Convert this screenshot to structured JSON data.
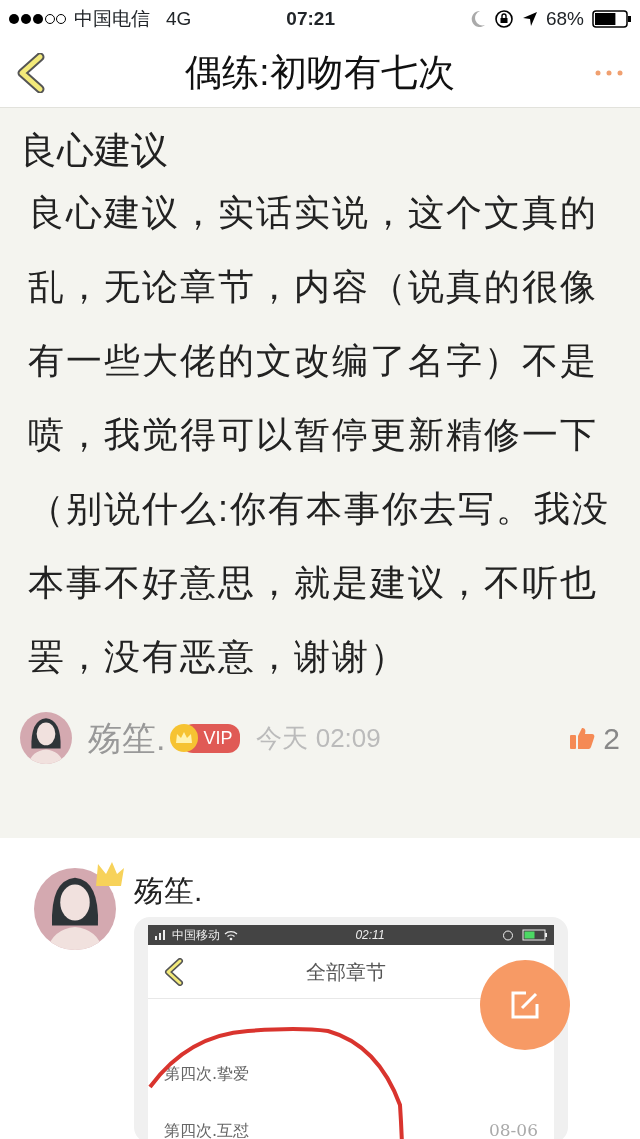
{
  "status_bar": {
    "carrier": "中国电信",
    "network": "4G",
    "time": "07:21",
    "battery": "68%"
  },
  "nav": {
    "title": "偶练:初吻有七次"
  },
  "comment": {
    "title": "良心建议",
    "body": "良心建议，实话实说，这个文真的乱，无论章节，内容（说真的很像有一些大佬的文改编了名字）不是喷，我觉得可以暂停更新精修一下（别说什么:你有本事你去写。我没本事不好意思，就是建议，不听也罢，没有恶意，谢谢）",
    "author": "殇笙.",
    "vip_badge": "VIP",
    "time": "今天 02:09",
    "likes": "2"
  },
  "reply": {
    "author": "殇笙.",
    "image": {
      "carrier": "中国移动",
      "time": "02:11",
      "title": "全部章节",
      "chapters": [
        {
          "name": "第四次.挚爱"
        },
        {
          "name": "第四次.互怼",
          "date": "08-06"
        }
      ]
    }
  }
}
